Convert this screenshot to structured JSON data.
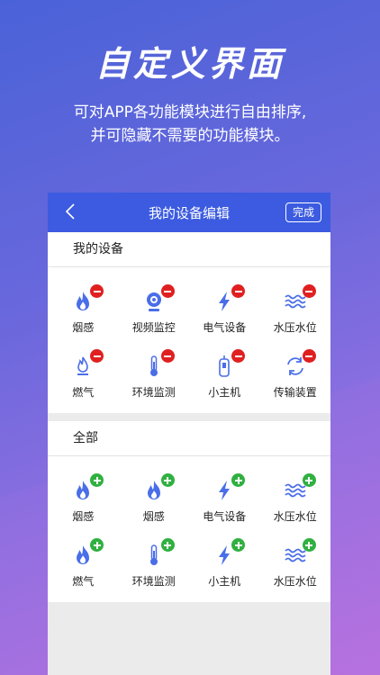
{
  "hero": {
    "title": "自定义界面",
    "subtitle_line1": "可对APP各功能模块进行自由排序,",
    "subtitle_line2": "并可隐藏不需要的功能模块。"
  },
  "navbar": {
    "title": "我的设备编辑",
    "done_label": "完成"
  },
  "my_devices": {
    "header": "我的设备",
    "items": [
      {
        "label": "烟感",
        "icon": "flame-icon"
      },
      {
        "label": "视频监控",
        "icon": "camera-icon"
      },
      {
        "label": "电气设备",
        "icon": "lightning-icon"
      },
      {
        "label": "水压水位",
        "icon": "water-wave-icon"
      },
      {
        "label": "燃气",
        "icon": "gas-flame-icon"
      },
      {
        "label": "环境监测",
        "icon": "thermometer-icon"
      },
      {
        "label": "小主机",
        "icon": "host-device-icon"
      },
      {
        "label": "传输装置",
        "icon": "transfer-icon"
      }
    ]
  },
  "all_devices": {
    "header": "全部",
    "items": [
      {
        "label": "烟感",
        "icon": "flame-icon"
      },
      {
        "label": "烟感",
        "icon": "flame-icon"
      },
      {
        "label": "电气设备",
        "icon": "lightning-icon"
      },
      {
        "label": "水压水位",
        "icon": "water-wave-icon"
      },
      {
        "label": "燃气",
        "icon": "flame-icon"
      },
      {
        "label": "环境监测",
        "icon": "thermometer-icon"
      },
      {
        "label": "小主机",
        "icon": "lightning-icon"
      },
      {
        "label": "水压水位",
        "icon": "water-wave-icon"
      }
    ]
  },
  "colors": {
    "accent": "#3c5be0",
    "remove": "#e02020",
    "add": "#30b040",
    "icon": "#4a6ee8"
  }
}
